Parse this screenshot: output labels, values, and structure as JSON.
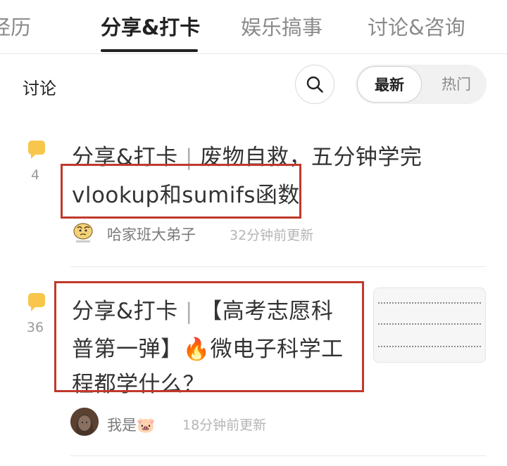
{
  "tabs": [
    {
      "label": "经历",
      "active": false
    },
    {
      "label": "分享&打卡",
      "active": true
    },
    {
      "label": "娱乐搞事",
      "active": false
    },
    {
      "label": "讨论&咨询",
      "active": false
    }
  ],
  "section": {
    "title": "讨论",
    "sort_options": [
      {
        "label": "最新",
        "selected": true
      },
      {
        "label": "热门",
        "selected": false
      }
    ]
  },
  "posts": [
    {
      "comment_count": "4",
      "title_prefix": "分享&打卡",
      "separator": "|",
      "title_line1": "废物自救，五分钟学完",
      "title_line2": "vlookup和sumifs函数",
      "author": "哈家班大弟子",
      "time": "32分钟前更新"
    },
    {
      "comment_count": "36",
      "title_prefix": "分享&打卡",
      "separator": "|",
      "title_line1": "【高考志愿科",
      "title_line2_a": "普第一弹】",
      "title_line2_emoji": "🔥",
      "title_line2_b": "微电子科学工",
      "title_line3": "程都学什么？",
      "author": "我是",
      "author_emoji": "🐷",
      "time": "18分钟前更新"
    }
  ],
  "colors": {
    "highlight_box": "#c0392b",
    "comment_icon": "#f7c64b"
  }
}
